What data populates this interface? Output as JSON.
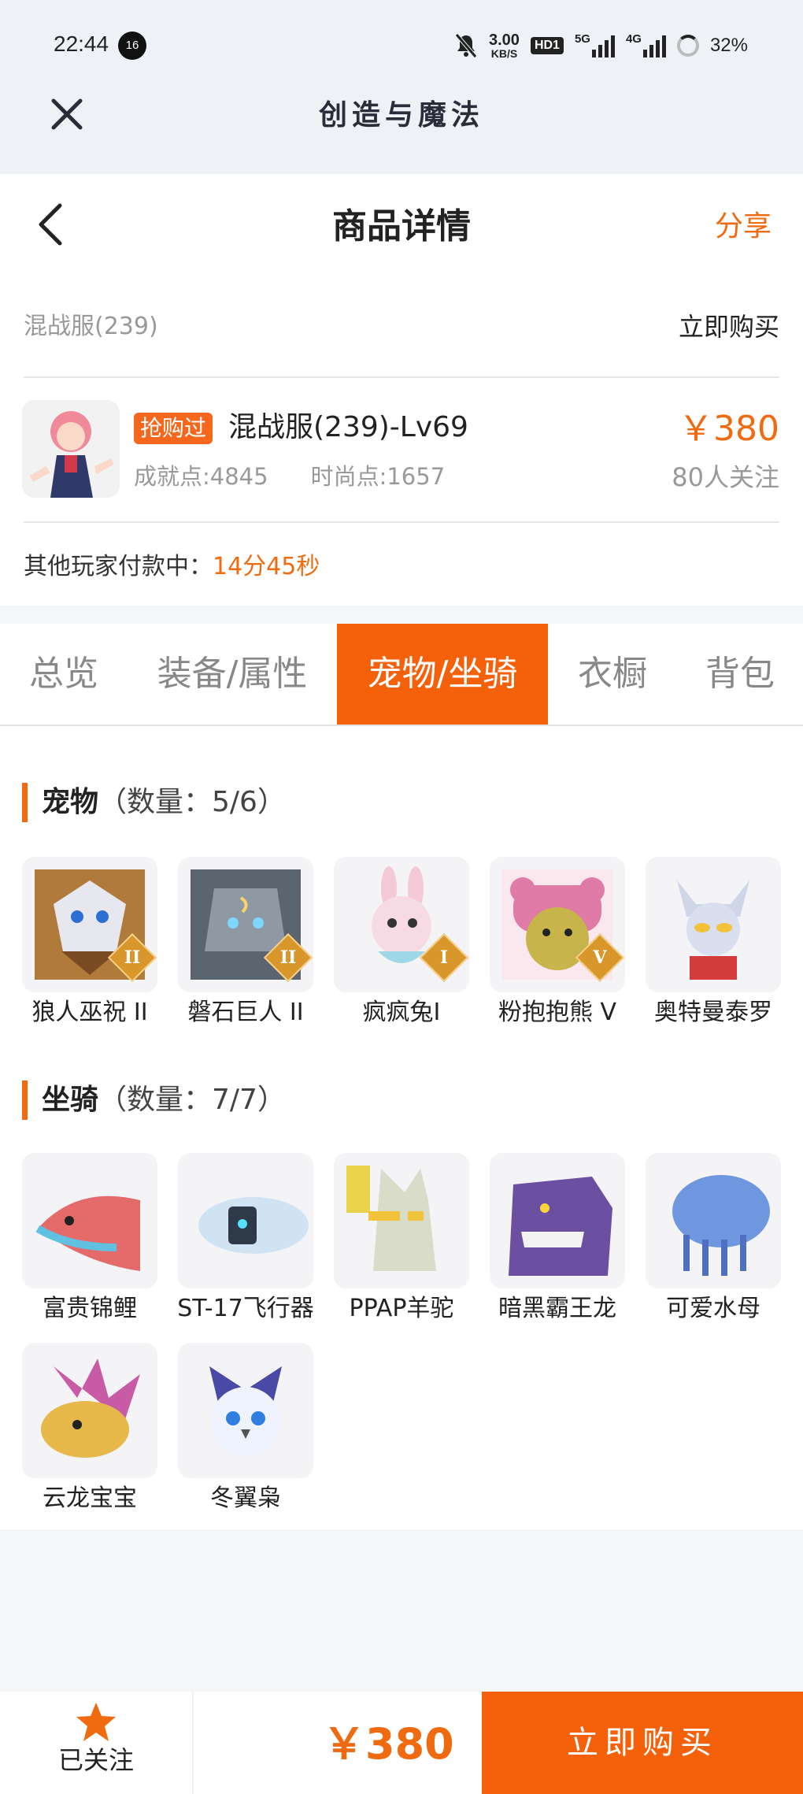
{
  "status_bar": {
    "time": "22:44",
    "notif_count": "16",
    "speed": "3.00",
    "speed_unit": "KB/S",
    "hd": "HD1",
    "net1": "5G",
    "net2": "4G",
    "battery": "32%"
  },
  "app": {
    "title": "创造与魔法"
  },
  "header": {
    "title": "商品详情",
    "share_label": "分享"
  },
  "listing": {
    "server": "混战服(239)",
    "buy_now_link": "立即购买",
    "tag": "抢购过",
    "name": "混战服(239)-Lv69",
    "achievement": "成就点:4845",
    "fashion": "时尚点:1657",
    "price": "￥380",
    "followers": "80人关注",
    "paying_prefix": "其他玩家付款中：",
    "paying_timer": "14分45秒"
  },
  "tabs": [
    {
      "label": "总览",
      "active": false
    },
    {
      "label": "装备/属性",
      "active": false
    },
    {
      "label": "宠物/坐骑",
      "active": true
    },
    {
      "label": "衣橱",
      "active": false
    },
    {
      "label": "背包",
      "active": false
    }
  ],
  "pets": {
    "title": "宠物",
    "count": "（数量：5/6）",
    "items": [
      {
        "name": "狼人巫祝 II",
        "badge": "II",
        "color": "#b07a3a"
      },
      {
        "name": "磐石巨人 II",
        "badge": "II",
        "color": "#5b6570"
      },
      {
        "name": "疯疯兔I",
        "badge": "I",
        "color": "#f3c9d6"
      },
      {
        "name": "粉抱抱熊 V",
        "badge": "V",
        "color": "#e07aa6"
      },
      {
        "name": "奥特曼泰罗",
        "badge": "",
        "color": "#cfd6e8"
      }
    ]
  },
  "mounts": {
    "title": "坐骑",
    "count": "（数量：7/7）",
    "items": [
      {
        "name": "富贵锦鲤",
        "color": "#e56a6a"
      },
      {
        "name": "ST-17飞行器",
        "color": "#cfe3f2"
      },
      {
        "name": "PPAP羊驼",
        "color": "#d8dcc9"
      },
      {
        "name": "暗黑霸王龙",
        "color": "#6b4fa0"
      },
      {
        "name": "可爱水母",
        "color": "#6f97e0"
      },
      {
        "name": "云龙宝宝",
        "color": "#e6b84a"
      },
      {
        "name": "冬翼枭",
        "color": "#9fb7ea"
      }
    ]
  },
  "bottom": {
    "fav_label": "已关注",
    "price": "￥380",
    "buy_label": "立即购买"
  }
}
